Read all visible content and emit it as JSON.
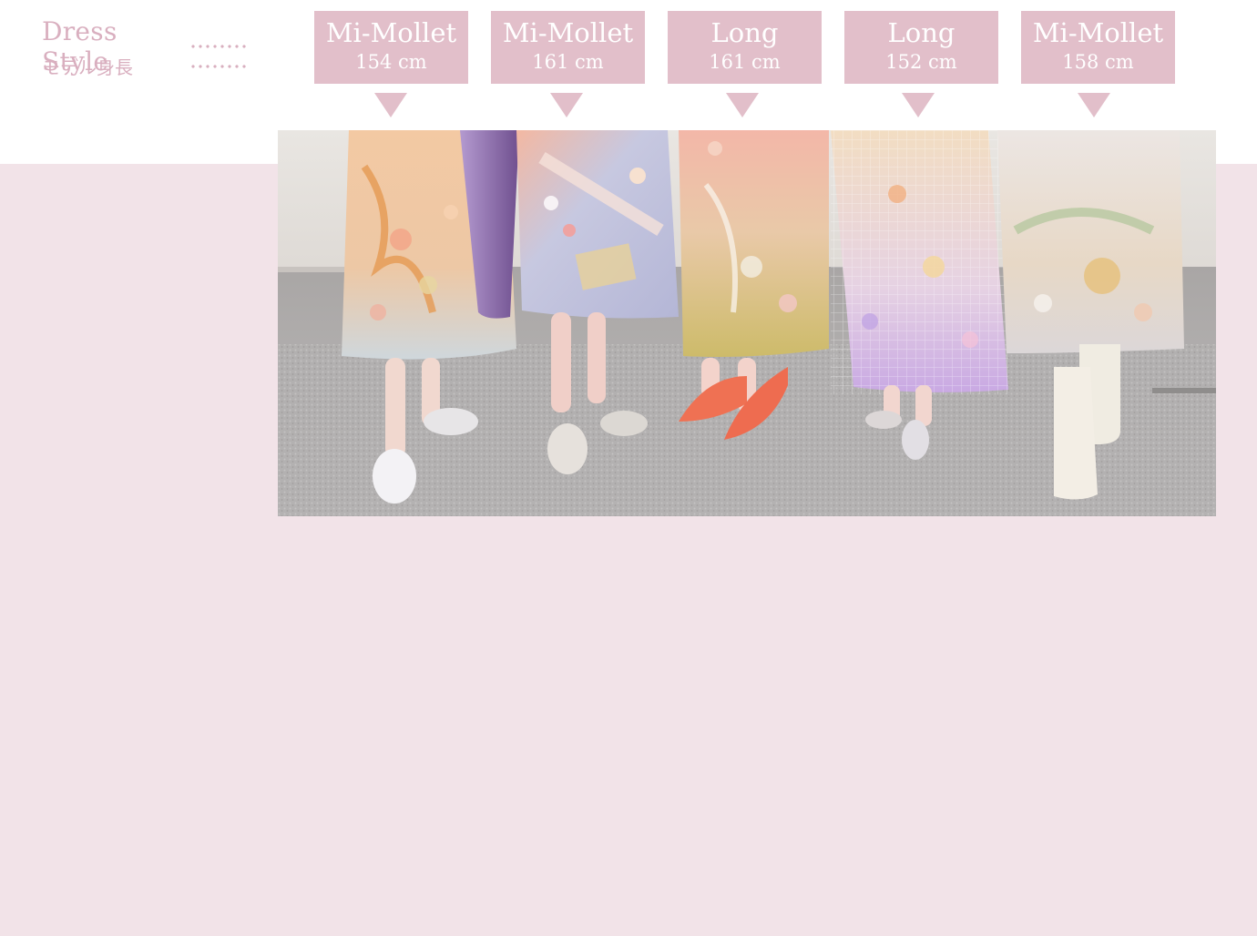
{
  "legend": {
    "style_label": "Dress Style",
    "height_label": "モデル身長"
  },
  "models": [
    {
      "style": "Mi-Mollet",
      "height": "154 cm"
    },
    {
      "style": "Mi-Mollet",
      "height": "161 cm"
    },
    {
      "style": "Long",
      "height": "161 cm"
    },
    {
      "style": "Long",
      "height": "152 cm"
    },
    {
      "style": "Mi-Mollet",
      "height": "158 cm"
    }
  ],
  "colors": {
    "accent": "#e2bfca",
    "label_text": "#d9afbf",
    "band": "#f2e3e8"
  }
}
